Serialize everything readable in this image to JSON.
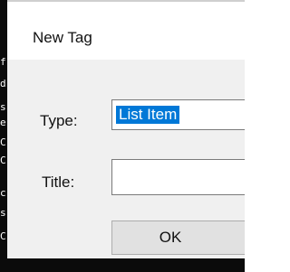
{
  "background_terminal": {
    "glyphs": [
      "f",
      "d",
      "s",
      "e",
      "C",
      "C",
      "c",
      "s",
      "C"
    ]
  },
  "dialog": {
    "title": "New Tag",
    "type_label": "Type:",
    "type_value": "List Item",
    "title_label": "Title:",
    "title_value": "",
    "ok_label": "OK"
  },
  "colors": {
    "selection": "#0078d7",
    "client_background": "#f0f0f0",
    "terminal_background": "#0b0b0b"
  }
}
